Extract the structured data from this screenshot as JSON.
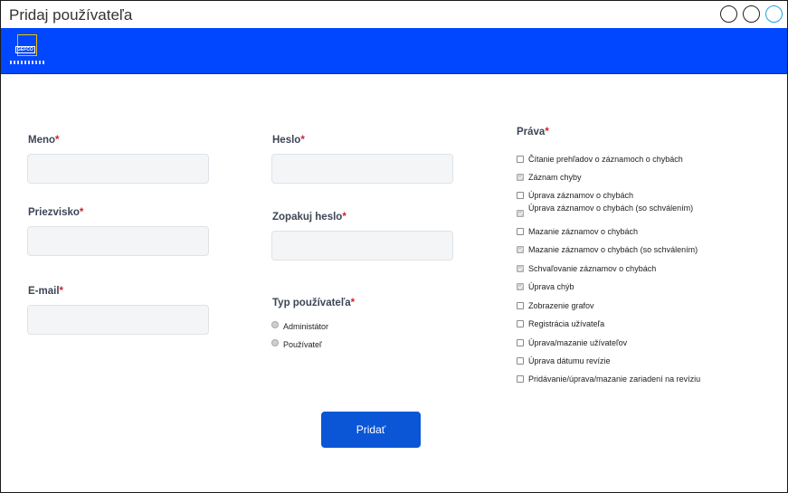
{
  "window": {
    "title": "Pridaj používateľa"
  },
  "form": {
    "meno_label": "Meno",
    "priezvisko_label": "Priezvisko",
    "email_label": "E-mail",
    "heslo_label": "Heslo",
    "zopakuj_label": "Zopakuj heslo",
    "typ_label": "Typ používateľa",
    "required_mark": "*",
    "roles": [
      "Administátor",
      "Používateľ"
    ],
    "prava_label": "Práva",
    "permissions": [
      {
        "label": "Čítanie prehľadov o záznamoch o chybách",
        "checked": false
      },
      {
        "label": "Záznam chyby",
        "checked": true
      },
      {
        "label": "Úprava záznamov o chybách",
        "checked": false
      },
      {
        "label": "Úprava záznamov o chybách (so schválením)",
        "checked": true
      },
      {
        "label": "Mazanie záznamov o chybách",
        "checked": false
      },
      {
        "label": "Mazanie záznamov o chybách (so schválením)",
        "checked": true
      },
      {
        "label": "Schvaľovanie záznamov o chybách",
        "checked": true
      },
      {
        "label": "Úprava chýb",
        "checked": true
      },
      {
        "label": "Zobrazenie grafov",
        "checked": false
      },
      {
        "label": "Registrácia užívateľa",
        "checked": false
      },
      {
        "label": "Úprava/mazanie užívateľov",
        "checked": false
      },
      {
        "label": "Úprava dátumu revízie",
        "checked": false
      },
      {
        "label": "Pridávanie/úprava/mazanie zariadení na revíziu",
        "checked": false
      }
    ],
    "submit_label": "Pridať"
  }
}
